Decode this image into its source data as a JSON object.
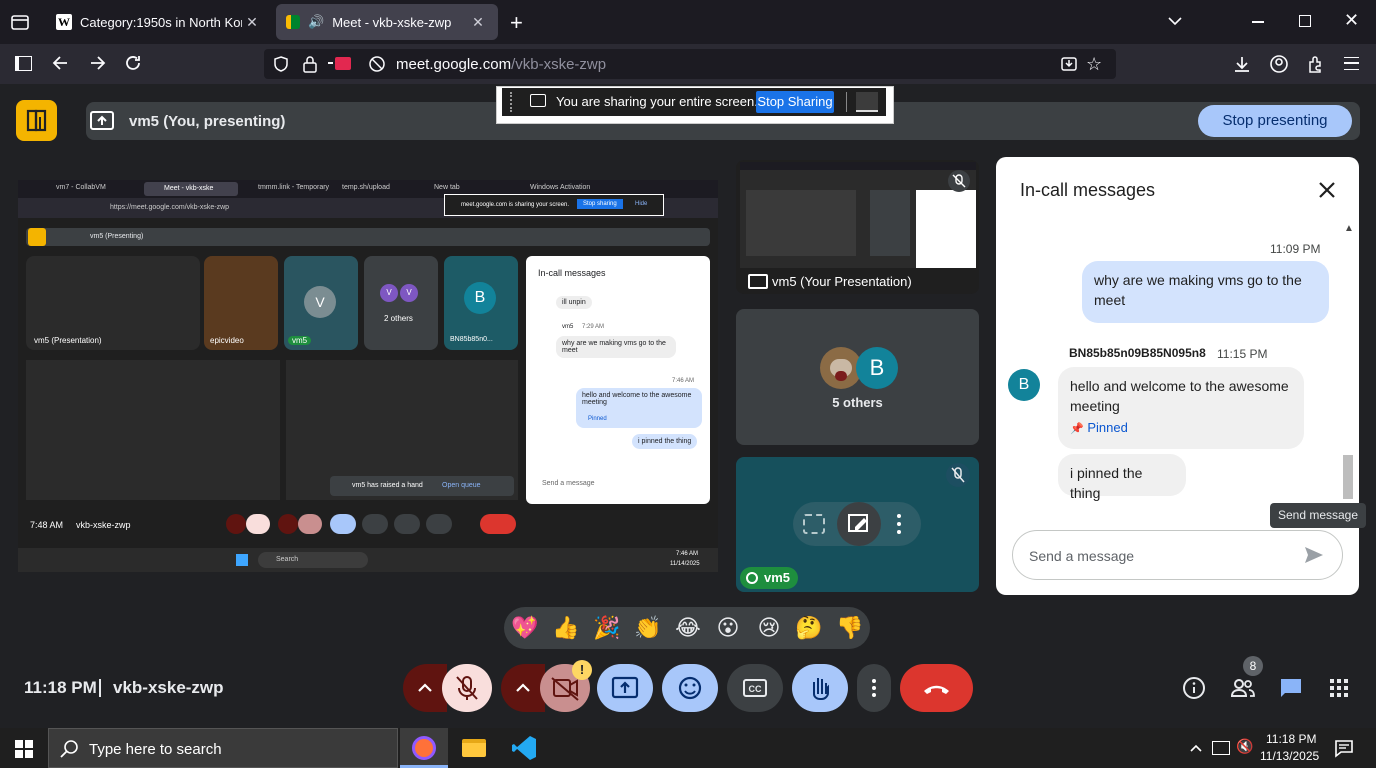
{
  "browser": {
    "tabs": [
      {
        "title": "Category:1950s in North Korea",
        "active": false
      },
      {
        "title": "Meet - vkb-xske-zwp",
        "active": true
      }
    ],
    "url_host": "meet.google.com",
    "url_path": "/vkb-xske-zwp"
  },
  "share_banner": {
    "text": "You are sharing your entire screen.",
    "stop_sharing_label": "Stop Sharing"
  },
  "presenting_bar": {
    "presenter": "vm5 (You, presenting)",
    "stop_label": "Stop presenting"
  },
  "tiles": {
    "presentation_label": "vm5 (Your Presentation)",
    "others_count": "5 others",
    "avatar_letter": "B",
    "self_name": "vm5"
  },
  "chat": {
    "title": "In-call messages",
    "messages": [
      {
        "time": "11:09 PM",
        "text": "why are we making vms go to the meet",
        "own": true
      },
      {
        "sender": "BN85b85n09B85N095n8",
        "time": "11:15 PM",
        "text": "hello and welcome to the awesome meeting",
        "pinned_label": "Pinned"
      },
      {
        "text": "i pinned the thing"
      }
    ],
    "input_placeholder": "Send a message",
    "tooltip": "Send message",
    "avatar_letter": "B"
  },
  "reactions": [
    "💖",
    "👍",
    "🎉",
    "👏",
    "😂",
    "😮",
    "😢",
    "🤔",
    "👎"
  ],
  "footer": {
    "time": "11:18 PM",
    "meeting_code": "vkb-xske-zwp",
    "people_count": "8",
    "camera_warning": "!"
  },
  "inner_share": {
    "tabs": [
      "vm7 - CollabVM",
      "Meet - vkb-xske",
      "tmmm.link - Temporary",
      "temp.sh/upload",
      "New tab",
      "Windows Activation"
    ],
    "url": "https://meet.google.com/vkb-xske-zwp",
    "banner_text": "meet.google.com is sharing your screen.",
    "banner_stop": "Stop sharing",
    "banner_hide": "Hide",
    "presenting": "vm5 (Presenting)",
    "tile_names": [
      "vm5 (Presentation)",
      "epicvideo",
      "vm5",
      "2 others",
      "BN85b85n0..."
    ],
    "tile_letters": [
      "V",
      "V",
      "V",
      "B"
    ],
    "chat_title": "In-call messages",
    "chat_items": [
      "ill unpin",
      "vm5",
      "7:29 AM",
      "why are we making vms go to the meet",
      "7:46 AM",
      "hello and welcome to the awesome meeting",
      "Pinned",
      "i pinned the thing",
      "Send a message"
    ],
    "raise_hand_text": "vm5 has raised a hand",
    "raise_hand_action": "Open queue",
    "time": "7:48 AM",
    "code": "vkb-xske-zwp",
    "taskbar_search": "Search",
    "clock_time": "7:46 AM",
    "clock_date": "11/14/2025"
  },
  "taskbar": {
    "search_placeholder": "Type here to search",
    "time": "11:18 PM",
    "date": "11/13/2025"
  },
  "colors": {
    "accent_blue": "#0b57d0",
    "chip_blue": "#a8c7fa",
    "end_call_red": "#dc362e",
    "muted_bg": "#f9dedc",
    "dark_red": "#601410",
    "meet_yellow": "#f4b400",
    "teal_avatar": "#12839a"
  }
}
